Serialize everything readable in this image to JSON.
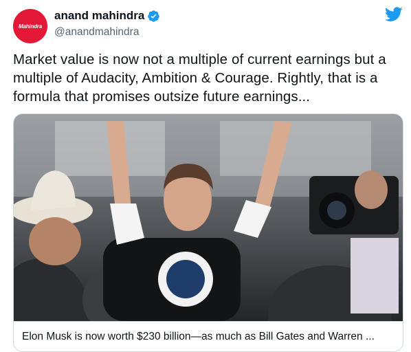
{
  "author": {
    "display_name": "anand mahindra",
    "handle": "@anandmahindra",
    "avatar_text": "Mahindra",
    "verified": true
  },
  "tweet": {
    "text": "Market value is now not a multiple of current earnings but a multiple of Audacity, Ambition & Courage. Rightly, that is a formula that promises outsize future earnings..."
  },
  "card": {
    "title": "Elon Musk is now worth $230 billion—as much as Bill Gates and Warren ..."
  },
  "colors": {
    "twitter_blue": "#1d9bf0",
    "brand_red": "#e31837",
    "text_primary": "#0f1419",
    "text_secondary": "#536471"
  },
  "icons": [
    "verified-badge-icon",
    "twitter-bird-icon"
  ]
}
